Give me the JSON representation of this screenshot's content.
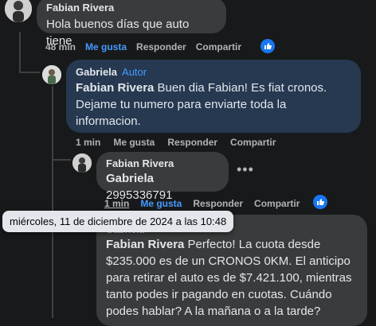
{
  "comments": [
    {
      "author": "Fabian Rivera",
      "text": "Hola buenos días que auto tiene",
      "time": "48 min",
      "like": "Me gusta",
      "reply": "Responder",
      "share": "Compartir"
    },
    {
      "author": "Gabriela",
      "badge": "Autor",
      "mention": "Fabian Rivera",
      "text": " Buen dia Fabian! Es fiat cronos. Dejame tu numero para enviarte toda la informacion.",
      "time": "1 min",
      "like": "Me gusta",
      "reply": "Responder",
      "share": "Compartir"
    },
    {
      "author": "Fabian Rivera",
      "mention": "Gabriela",
      "text": " 2995336791",
      "time": "1 min",
      "like": "Me gusta",
      "reply": "Responder",
      "share": "Compartir"
    },
    {
      "author": "Gabriela",
      "mention": "Fabian Rivera",
      "text": " Perfecto! La cuota desde $235.000 es de un CRONOS 0KM. El anticipo para retirar el auto es de $7.421.100, mientras tanto podes ir pagando en cuotas. Cuándo podes hablar? A la mañana o a la tarde?"
    }
  ],
  "tooltip": "miércoles, 11 de diciembre de 2024 a las 10:48",
  "icons": {
    "like": "thumbs-up-icon",
    "more": "more-options-icon"
  },
  "colors": {
    "background": "#18191a",
    "bubble": "#3a3b3c",
    "highlight_bubble": "#263951",
    "accent": "#4599ff"
  }
}
